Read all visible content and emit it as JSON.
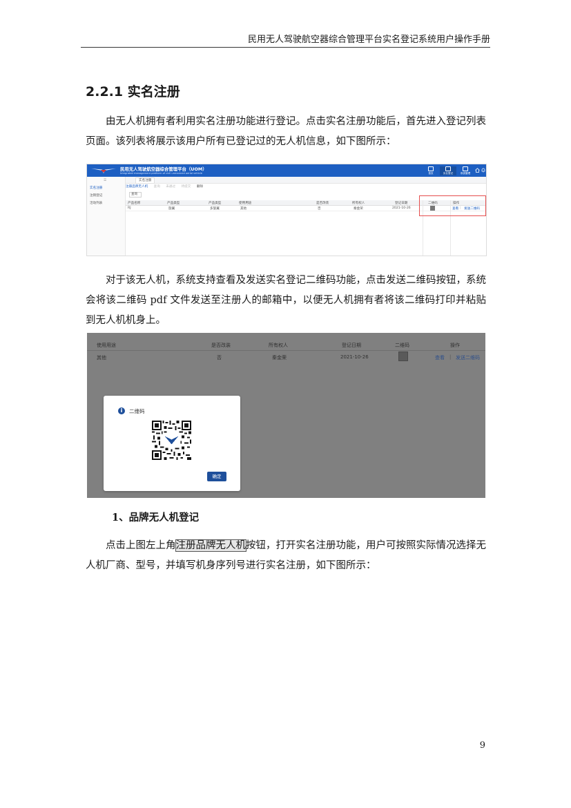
{
  "header": "民用无人驾驶航空器综合管理平台实名登记系统用户操作手册",
  "section_title": "2.2.1 实名注册",
  "para1": "由无人机拥有者利用实名注册功能进行登记。点击实名注册功能后，首先进入登记列表页面。该列表将展示该用户所有已登记过的无人机信息，如下图所示：",
  "para2": "对于该无人机，系统支持查看及发送实名登记二维码功能，点击发送二维码按钮，系统会将该二维码 pdf 文件发送至注册人的邮箱中，以便无人机拥有者将该二维码打印并粘贴到无人机机身上。",
  "subheading": "1、品牌无人机登记",
  "para3": {
    "before": "点击上图左上角",
    "highlight": "注册品牌无人机",
    "after": "按钮，打开实名注册功能，用户可按照实际情况选择无人机厂商、型号，并填写机身序列号进行实名注册，如下图所示："
  },
  "page_number": "9",
  "colors": {
    "brand_blue": "#1d5fc2",
    "dialog_button": "#1e4f9b",
    "red_box": "#e54d4d"
  },
  "screenshot1": {
    "title": "民用无人驾驶航空器综合管理平台（UOM）",
    "subtitle": "Integrated management platform of civil unmanned aerial vehicle",
    "nav": [
      "首页",
      "实名登记",
      "系统管理"
    ],
    "sidebar": [
      "实名注册",
      "注销登记",
      "活动列表"
    ],
    "tab": "实名注册",
    "filters": [
      "注册品牌无人机",
      "查询",
      "未通过",
      "待提交",
      "删除"
    ],
    "dropdown": "查询",
    "columns": [
      "产品名称",
      "产品类型",
      "产品类型",
      "使用用途",
      "是否改装",
      "所有权人",
      "登记日期",
      "二维码",
      "操作"
    ],
    "row": [
      "RJ",
      "旋翼",
      "多旋翼",
      "其他",
      "否",
      "秦金荣",
      "2021-10-26"
    ],
    "actions": [
      "查看",
      "发送二维码"
    ]
  },
  "screenshot2": {
    "columns": [
      "使用用途",
      "是否改装",
      "所有权人",
      "登记日期",
      "二维码",
      "操作"
    ],
    "row": [
      "其他",
      "否",
      "秦金荣",
      "2021-10-26"
    ],
    "actions": [
      "查看",
      "发送二维码"
    ],
    "dialog_title": "二维码",
    "dialog_button": "确定"
  }
}
